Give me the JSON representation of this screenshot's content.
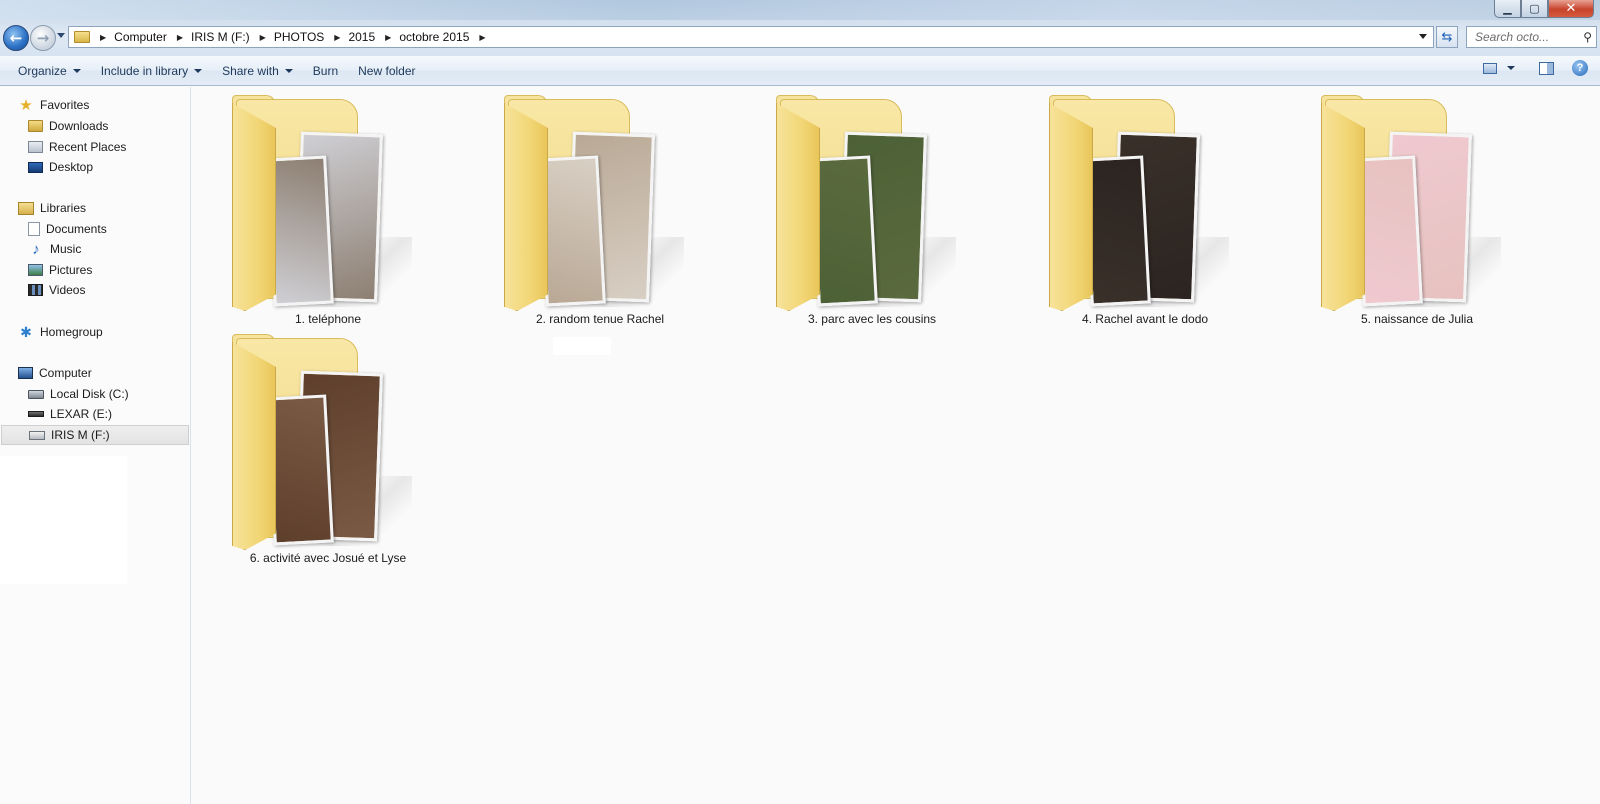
{
  "window": {
    "controls": {
      "minimize": "▁",
      "maximize": "▢",
      "close": "✕"
    }
  },
  "nav": {
    "back_icon": "back-arrow-icon",
    "forward_icon": "forward-arrow-icon"
  },
  "address": {
    "breadcrumbs": [
      "Computer",
      "IRIS M (F:)",
      "PHOTOS",
      "2015",
      "octobre 2015"
    ]
  },
  "search": {
    "placeholder": "Search octo..."
  },
  "toolbar": {
    "organize": "Organize",
    "include_in_library": "Include in library",
    "share_with": "Share with",
    "burn": "Burn",
    "new_folder": "New folder"
  },
  "sidebar": {
    "favorites": {
      "label": "Favorites",
      "items": [
        "Downloads",
        "Recent Places",
        "Desktop"
      ]
    },
    "libraries": {
      "label": "Libraries",
      "items": [
        "Documents",
        "Music",
        "Pictures",
        "Videos"
      ]
    },
    "homegroup": {
      "label": "Homegroup"
    },
    "computer": {
      "label": "Computer",
      "items": [
        "Local Disk (C:)",
        "LEXAR (E:)",
        "IRIS M (F:)"
      ],
      "selected": "IRIS M (F:)"
    }
  },
  "folders": [
    {
      "name": "1. teléphone",
      "photo_colors": [
        "#8d7f72",
        "#cfcfd4"
      ]
    },
    {
      "name": "2. random tenue Rachel",
      "photo_colors": [
        "#d8cfc4",
        "#b9a895"
      ]
    },
    {
      "name": "3. parc avec les cousins",
      "photo_colors": [
        "#5a6a3e",
        "#4d6136"
      ]
    },
    {
      "name": "4. Rachel avant le dodo",
      "photo_colors": [
        "#2b2420",
        "#3a302a"
      ]
    },
    {
      "name": "5. naissance de Julia",
      "photo_colors": [
        "#e7c2c0",
        "#efc9cf"
      ]
    },
    {
      "name": "6. activité avec Josué et Lyse",
      "photo_colors": [
        "#7a5a44",
        "#5e3f2c"
      ]
    }
  ]
}
